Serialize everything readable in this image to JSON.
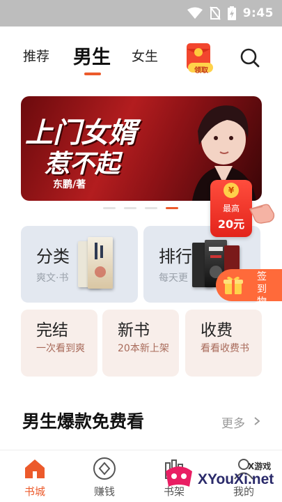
{
  "status_bar": {
    "time": "9:45"
  },
  "top_tabs": [
    {
      "label": "推荐",
      "active": false
    },
    {
      "label": "男生",
      "active": true
    },
    {
      "label": "女生",
      "active": false
    }
  ],
  "redpack": {
    "label": "领取"
  },
  "banner": {
    "title_line1": "上门女婿",
    "title_line2": "惹不起",
    "author": "东鹏/著",
    "page_count": 4,
    "active_page": 4
  },
  "reward": {
    "coin": "¥",
    "top_text": "最高",
    "amount": "20元"
  },
  "categories": [
    {
      "title": "分类",
      "subtitle": "爽文·书"
    },
    {
      "title": "排行",
      "subtitle": "每天更"
    }
  ],
  "signin": {
    "label": "签到物"
  },
  "quick_links": [
    {
      "title": "完结",
      "subtitle": "一次看到爽"
    },
    {
      "title": "新书",
      "subtitle": "20本新上架"
    },
    {
      "title": "收费",
      "subtitle": "看看收费书"
    }
  ],
  "section": {
    "title": "男生爆款免费看",
    "more": "更多"
  },
  "bottom_nav": [
    {
      "label": "书城",
      "icon": "house-icon",
      "active": true
    },
    {
      "label": "赚钱",
      "icon": "diamond-icon",
      "active": false
    },
    {
      "label": "书架",
      "icon": "bookshelf-icon",
      "active": false
    },
    {
      "label": "我的",
      "icon": "user-icon",
      "active": false
    }
  ],
  "watermark": {
    "text_small": "X游戏",
    "text_large": "XYouXi.net"
  },
  "colors": {
    "accent": "#ec5a2b",
    "status_bar": "#bdbdbd",
    "banner": "#b31d1f",
    "reward": "#e3241b"
  }
}
